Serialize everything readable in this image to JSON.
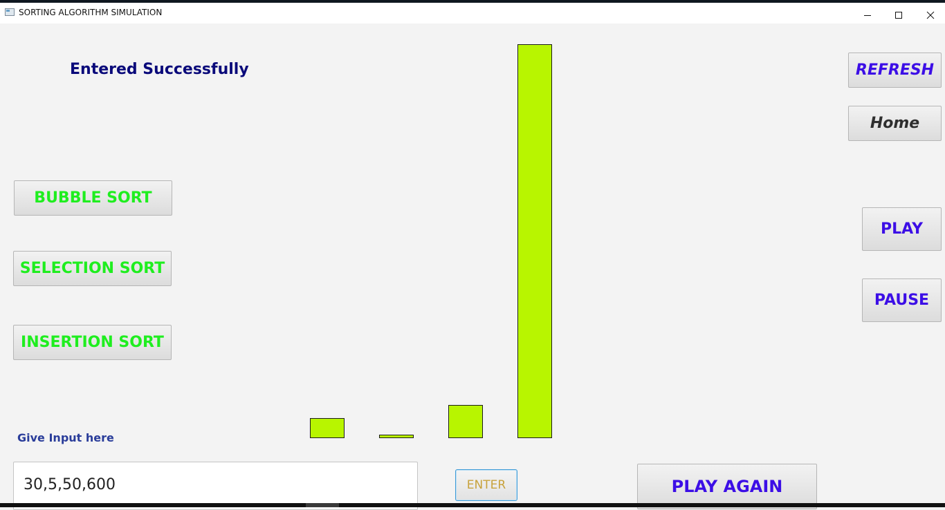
{
  "window": {
    "title": "SORTING ALGORITHM SIMULATION"
  },
  "status_message": "Entered Successfully",
  "sort_buttons": {
    "bubble": "BUBBLE SORT",
    "selection": "SELECTION SORT",
    "insertion": "INSERTION SORT"
  },
  "controls": {
    "refresh": "REFRESH",
    "home": "Home",
    "play": "PLAY",
    "pause": "PAUSE",
    "play_again": "PLAY AGAIN",
    "enter": "ENTER"
  },
  "input": {
    "label": "Give Input here",
    "value": "30,5,50,600"
  },
  "bars": {
    "values": [
      30,
      5,
      50,
      600
    ],
    "color": "#b8f500"
  },
  "colors": {
    "sort_button_text": "#1fee1f",
    "control_text": "#3c0ee6",
    "status_text": "#0a0a7a",
    "enter_text": "#c8a23c"
  }
}
